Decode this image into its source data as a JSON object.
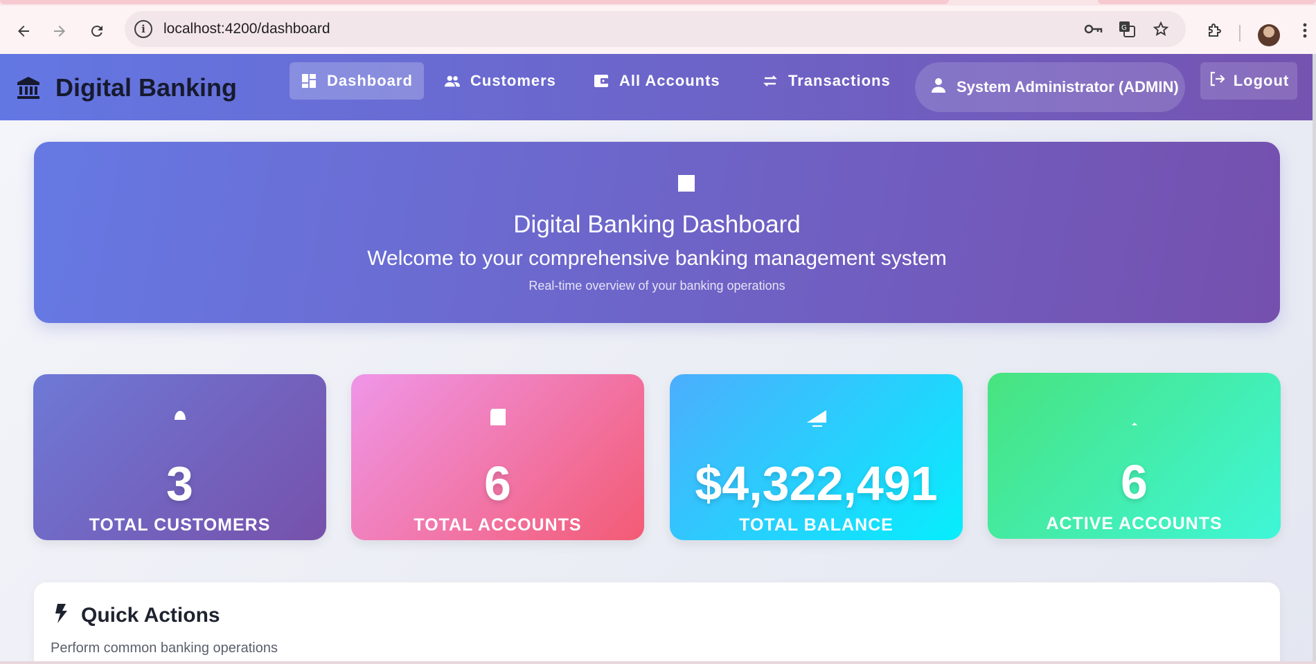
{
  "browser": {
    "url": "localhost:4200/dashboard",
    "icons": [
      "back-arrow-icon",
      "forward-arrow-icon",
      "reload-icon",
      "site-info-icon",
      "password-key-icon",
      "translate-icon",
      "bookmark-star-icon",
      "extensions-icon",
      "profile-avatar",
      "more-menu-icon"
    ]
  },
  "header": {
    "brand": "Digital Banking",
    "nav": [
      {
        "label": "Dashboard",
        "icon": "dashboard-icon",
        "active": true
      },
      {
        "label": "Customers",
        "icon": "people-icon",
        "active": false
      },
      {
        "label": "All Accounts",
        "icon": "wallet-icon",
        "active": false
      },
      {
        "label": "Transactions",
        "icon": "swap-arrows-icon",
        "active": false
      }
    ],
    "user": "System Administrator (ADMIN)",
    "logout": "Logout"
  },
  "hero": {
    "title": "Digital Banking Dashboard",
    "subtitle": "Welcome to your comprehensive banking management system",
    "note": "Real-time overview of your banking operations"
  },
  "stats": [
    {
      "value": "3",
      "label": "TOTAL CUSTOMERS",
      "color_from": "#6e79d6",
      "color_to": "#7651ab"
    },
    {
      "value": "6",
      "label": "TOTAL ACCOUNTS",
      "color_from": "#ef96e8",
      "color_to": "#f35b74"
    },
    {
      "value": "$4,322,491",
      "label": "TOTAL BALANCE",
      "color_from": "#4caefd",
      "color_to": "#06eefd"
    },
    {
      "value": "6",
      "label": "ACTIVE ACCOUNTS",
      "color_from": "#48e37f",
      "color_to": "#3ff6d7"
    }
  ],
  "quick_actions": {
    "title": "Quick Actions",
    "subtitle": "Perform common banking operations"
  },
  "colors": {
    "header_from": "#6377e3",
    "header_to": "#7553b0",
    "brand_text": "#161a2e"
  }
}
